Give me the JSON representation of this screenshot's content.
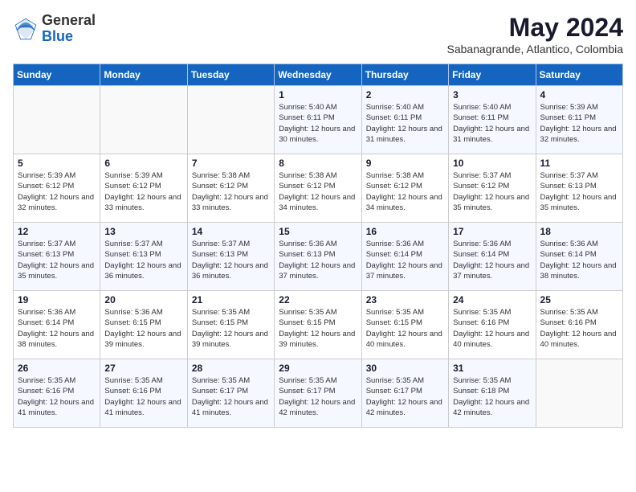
{
  "header": {
    "logo_general": "General",
    "logo_blue": "Blue",
    "title": "May 2024",
    "subtitle": "Sabanagrande, Atlantico, Colombia"
  },
  "days_of_week": [
    "Sunday",
    "Monday",
    "Tuesday",
    "Wednesday",
    "Thursday",
    "Friday",
    "Saturday"
  ],
  "weeks": [
    [
      {
        "day": "",
        "sunrise": "",
        "sunset": "",
        "daylight": ""
      },
      {
        "day": "",
        "sunrise": "",
        "sunset": "",
        "daylight": ""
      },
      {
        "day": "",
        "sunrise": "",
        "sunset": "",
        "daylight": ""
      },
      {
        "day": "1",
        "sunrise": "Sunrise: 5:40 AM",
        "sunset": "Sunset: 6:11 PM",
        "daylight": "Daylight: 12 hours and 30 minutes."
      },
      {
        "day": "2",
        "sunrise": "Sunrise: 5:40 AM",
        "sunset": "Sunset: 6:11 PM",
        "daylight": "Daylight: 12 hours and 31 minutes."
      },
      {
        "day": "3",
        "sunrise": "Sunrise: 5:40 AM",
        "sunset": "Sunset: 6:11 PM",
        "daylight": "Daylight: 12 hours and 31 minutes."
      },
      {
        "day": "4",
        "sunrise": "Sunrise: 5:39 AM",
        "sunset": "Sunset: 6:11 PM",
        "daylight": "Daylight: 12 hours and 32 minutes."
      }
    ],
    [
      {
        "day": "5",
        "sunrise": "Sunrise: 5:39 AM",
        "sunset": "Sunset: 6:12 PM",
        "daylight": "Daylight: 12 hours and 32 minutes."
      },
      {
        "day": "6",
        "sunrise": "Sunrise: 5:39 AM",
        "sunset": "Sunset: 6:12 PM",
        "daylight": "Daylight: 12 hours and 33 minutes."
      },
      {
        "day": "7",
        "sunrise": "Sunrise: 5:38 AM",
        "sunset": "Sunset: 6:12 PM",
        "daylight": "Daylight: 12 hours and 33 minutes."
      },
      {
        "day": "8",
        "sunrise": "Sunrise: 5:38 AM",
        "sunset": "Sunset: 6:12 PM",
        "daylight": "Daylight: 12 hours and 34 minutes."
      },
      {
        "day": "9",
        "sunrise": "Sunrise: 5:38 AM",
        "sunset": "Sunset: 6:12 PM",
        "daylight": "Daylight: 12 hours and 34 minutes."
      },
      {
        "day": "10",
        "sunrise": "Sunrise: 5:37 AM",
        "sunset": "Sunset: 6:12 PM",
        "daylight": "Daylight: 12 hours and 35 minutes."
      },
      {
        "day": "11",
        "sunrise": "Sunrise: 5:37 AM",
        "sunset": "Sunset: 6:13 PM",
        "daylight": "Daylight: 12 hours and 35 minutes."
      }
    ],
    [
      {
        "day": "12",
        "sunrise": "Sunrise: 5:37 AM",
        "sunset": "Sunset: 6:13 PM",
        "daylight": "Daylight: 12 hours and 35 minutes."
      },
      {
        "day": "13",
        "sunrise": "Sunrise: 5:37 AM",
        "sunset": "Sunset: 6:13 PM",
        "daylight": "Daylight: 12 hours and 36 minutes."
      },
      {
        "day": "14",
        "sunrise": "Sunrise: 5:37 AM",
        "sunset": "Sunset: 6:13 PM",
        "daylight": "Daylight: 12 hours and 36 minutes."
      },
      {
        "day": "15",
        "sunrise": "Sunrise: 5:36 AM",
        "sunset": "Sunset: 6:13 PM",
        "daylight": "Daylight: 12 hours and 37 minutes."
      },
      {
        "day": "16",
        "sunrise": "Sunrise: 5:36 AM",
        "sunset": "Sunset: 6:14 PM",
        "daylight": "Daylight: 12 hours and 37 minutes."
      },
      {
        "day": "17",
        "sunrise": "Sunrise: 5:36 AM",
        "sunset": "Sunset: 6:14 PM",
        "daylight": "Daylight: 12 hours and 37 minutes."
      },
      {
        "day": "18",
        "sunrise": "Sunrise: 5:36 AM",
        "sunset": "Sunset: 6:14 PM",
        "daylight": "Daylight: 12 hours and 38 minutes."
      }
    ],
    [
      {
        "day": "19",
        "sunrise": "Sunrise: 5:36 AM",
        "sunset": "Sunset: 6:14 PM",
        "daylight": "Daylight: 12 hours and 38 minutes."
      },
      {
        "day": "20",
        "sunrise": "Sunrise: 5:36 AM",
        "sunset": "Sunset: 6:15 PM",
        "daylight": "Daylight: 12 hours and 39 minutes."
      },
      {
        "day": "21",
        "sunrise": "Sunrise: 5:35 AM",
        "sunset": "Sunset: 6:15 PM",
        "daylight": "Daylight: 12 hours and 39 minutes."
      },
      {
        "day": "22",
        "sunrise": "Sunrise: 5:35 AM",
        "sunset": "Sunset: 6:15 PM",
        "daylight": "Daylight: 12 hours and 39 minutes."
      },
      {
        "day": "23",
        "sunrise": "Sunrise: 5:35 AM",
        "sunset": "Sunset: 6:15 PM",
        "daylight": "Daylight: 12 hours and 40 minutes."
      },
      {
        "day": "24",
        "sunrise": "Sunrise: 5:35 AM",
        "sunset": "Sunset: 6:16 PM",
        "daylight": "Daylight: 12 hours and 40 minutes."
      },
      {
        "day": "25",
        "sunrise": "Sunrise: 5:35 AM",
        "sunset": "Sunset: 6:16 PM",
        "daylight": "Daylight: 12 hours and 40 minutes."
      }
    ],
    [
      {
        "day": "26",
        "sunrise": "Sunrise: 5:35 AM",
        "sunset": "Sunset: 6:16 PM",
        "daylight": "Daylight: 12 hours and 41 minutes."
      },
      {
        "day": "27",
        "sunrise": "Sunrise: 5:35 AM",
        "sunset": "Sunset: 6:16 PM",
        "daylight": "Daylight: 12 hours and 41 minutes."
      },
      {
        "day": "28",
        "sunrise": "Sunrise: 5:35 AM",
        "sunset": "Sunset: 6:17 PM",
        "daylight": "Daylight: 12 hours and 41 minutes."
      },
      {
        "day": "29",
        "sunrise": "Sunrise: 5:35 AM",
        "sunset": "Sunset: 6:17 PM",
        "daylight": "Daylight: 12 hours and 42 minutes."
      },
      {
        "day": "30",
        "sunrise": "Sunrise: 5:35 AM",
        "sunset": "Sunset: 6:17 PM",
        "daylight": "Daylight: 12 hours and 42 minutes."
      },
      {
        "day": "31",
        "sunrise": "Sunrise: 5:35 AM",
        "sunset": "Sunset: 6:18 PM",
        "daylight": "Daylight: 12 hours and 42 minutes."
      },
      {
        "day": "",
        "sunrise": "",
        "sunset": "",
        "daylight": ""
      }
    ]
  ]
}
